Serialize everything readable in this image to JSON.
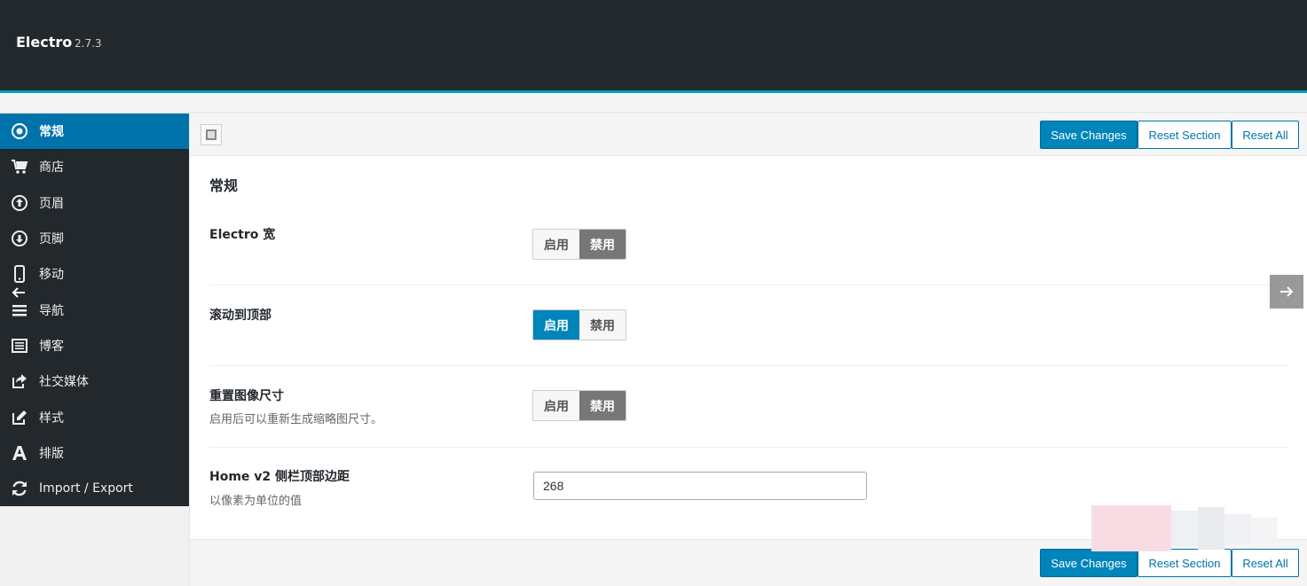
{
  "header": {
    "title": "Electro",
    "version": "2.7.3"
  },
  "sidebar": {
    "items": [
      {
        "label": "常规",
        "icon": "dot-circle-icon",
        "active": true
      },
      {
        "label": "商店",
        "icon": "shopping-cart-icon"
      },
      {
        "label": "页眉",
        "icon": "arrow-circle-up-icon"
      },
      {
        "label": "页脚",
        "icon": "arrow-circle-down-icon"
      },
      {
        "label": "移动",
        "icon": "mobile-icon"
      },
      {
        "label": "导航",
        "icon": "bars-icon"
      },
      {
        "label": "博客",
        "icon": "list-alt-icon"
      },
      {
        "label": "社交媒体",
        "icon": "share-square-icon"
      },
      {
        "label": "样式",
        "icon": "edit-icon"
      },
      {
        "label": "排版",
        "icon": "font-icon"
      },
      {
        "label": "Import / Export",
        "icon": "refresh-icon"
      }
    ]
  },
  "toolbar": {
    "save": "Save Changes",
    "reset_section": "Reset Section",
    "reset_all": "Reset All"
  },
  "section": {
    "title": "常规"
  },
  "settings": [
    {
      "label": "Electro 宽",
      "desc": "",
      "on": "启用",
      "off": "禁用",
      "state": "off"
    },
    {
      "label": "滚动到顶部",
      "desc": "",
      "on": "启用",
      "off": "禁用",
      "state": "on"
    },
    {
      "label": "重置图像尺寸",
      "desc": "启用后可以重新生成缩略图尺寸。",
      "on": "启用",
      "off": "禁用",
      "state": "off"
    },
    {
      "label": "Home v2 侧栏顶部边距",
      "desc": "以像素为单位的值",
      "value": "268"
    }
  ],
  "colors": {
    "header_bg": "#23282d",
    "accent": "#0085ba",
    "sidebar_active": "#0073aa"
  }
}
